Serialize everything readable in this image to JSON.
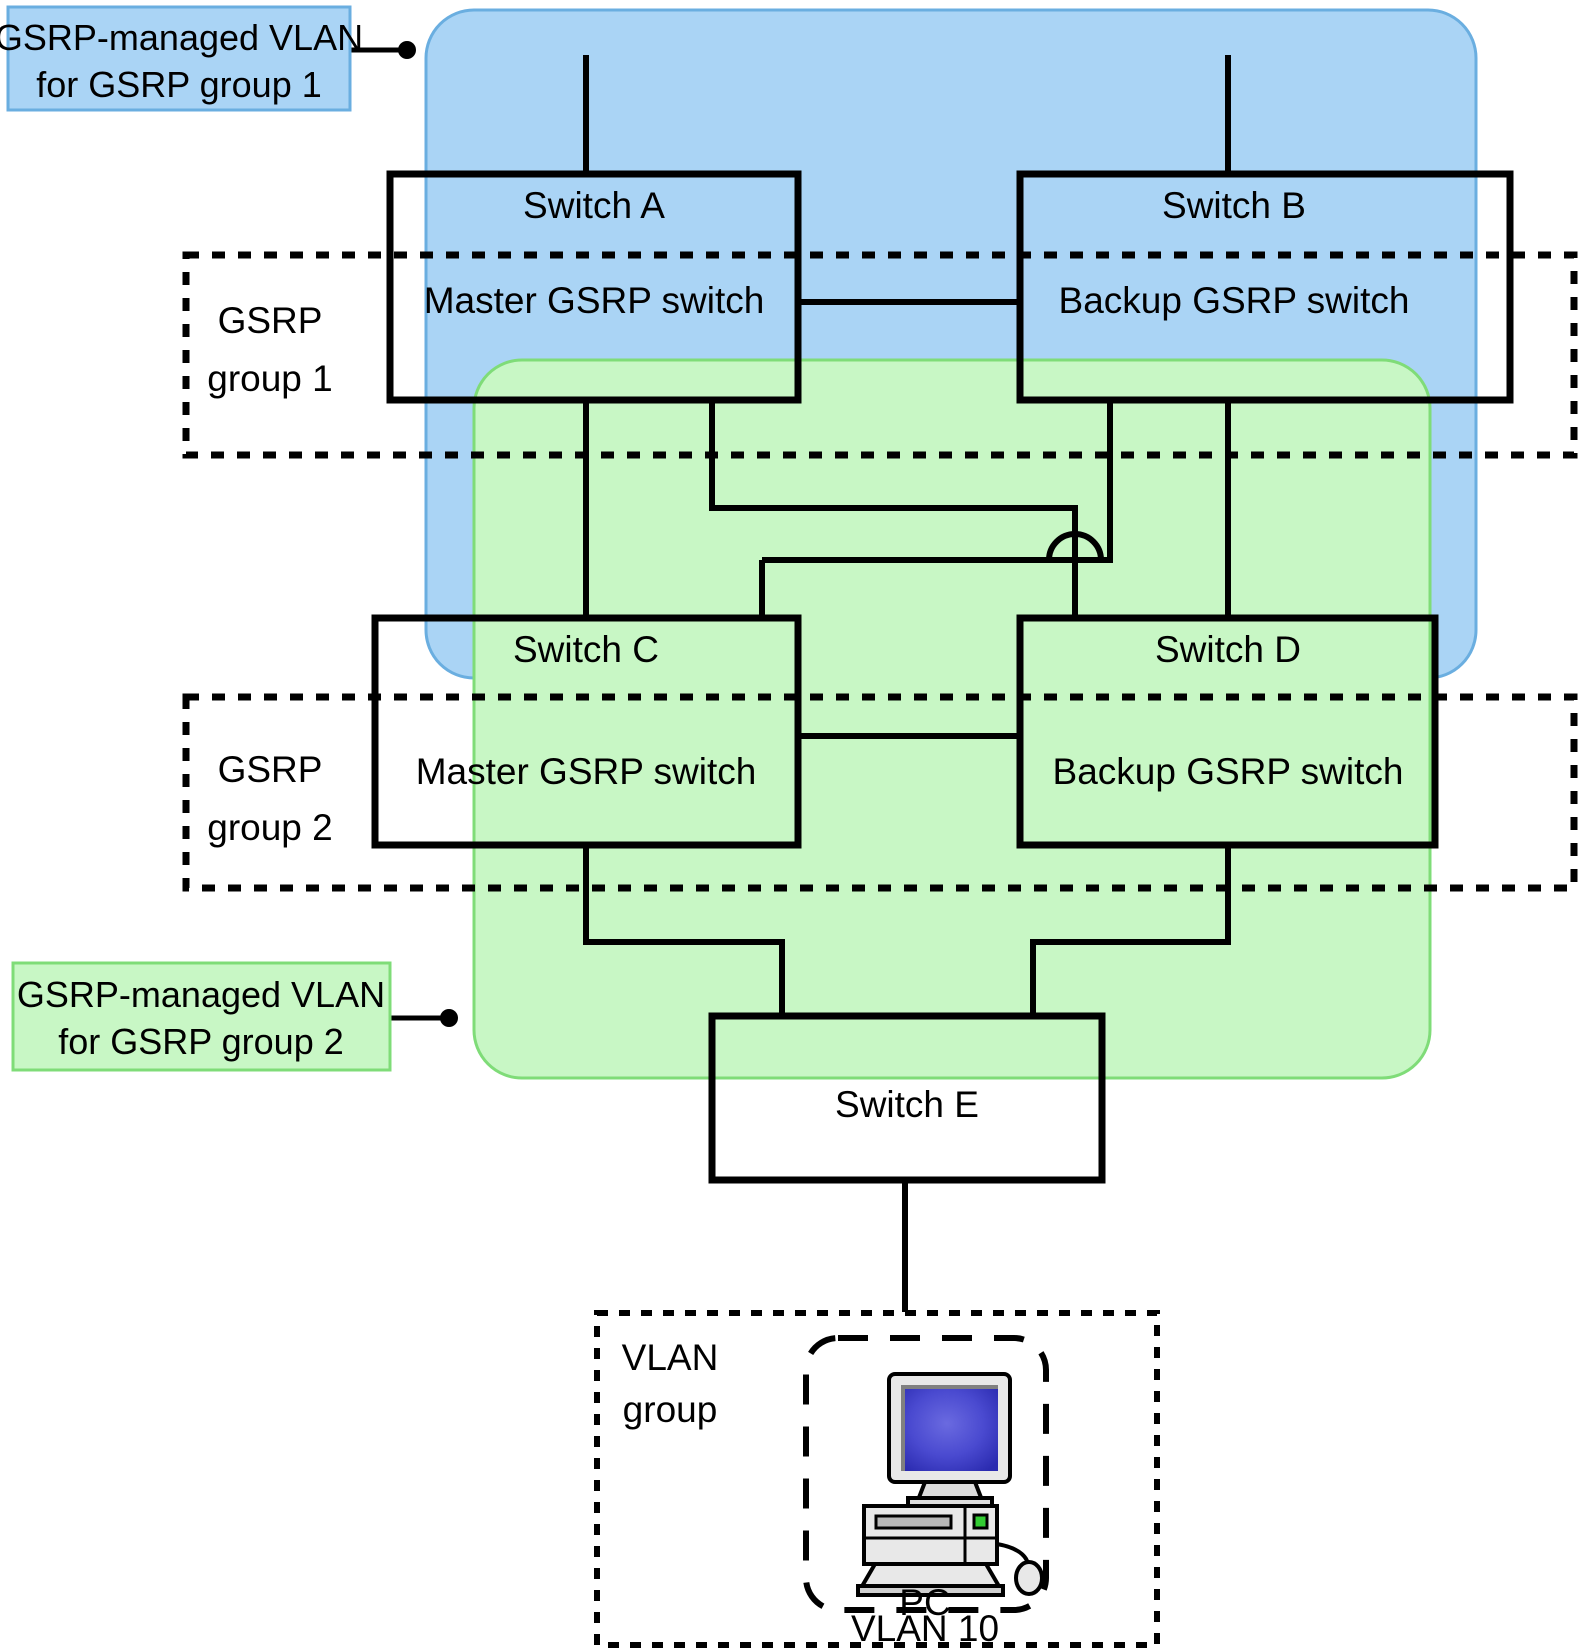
{
  "diagram": {
    "type": "network-topology",
    "title_present": false,
    "colors": {
      "vlan_group1_fill": "#aad4f5",
      "vlan_group1_stroke": "#6aaee0",
      "vlan_group2_fill": "#c8f7c5",
      "vlan_group2_stroke": "#7fdc78",
      "line": "#000000",
      "pc_screen": "#4040c0",
      "pc_case": "#e0e0e0",
      "pc_led": "#33cc33"
    },
    "legend": [
      {
        "id": "legend-group-1",
        "line1": "GSRP-managed VLAN",
        "line2": "for GSRP group 1",
        "fill": "#aad4f5"
      },
      {
        "id": "legend-group-2",
        "line1": "GSRP-managed VLAN",
        "line2": "for GSRP group 2",
        "fill": "#c8f7c5"
      }
    ],
    "group_boxes": [
      {
        "id": "gsrp-group-1-box",
        "line1": "GSRP",
        "line2": "group 1"
      },
      {
        "id": "gsrp-group-2-box",
        "line1": "GSRP",
        "line2": "group 2"
      }
    ],
    "switches": [
      {
        "id": "switch-a",
        "name": "Switch A",
        "role": "Master GSRP switch"
      },
      {
        "id": "switch-b",
        "name": "Switch B",
        "role": "Backup GSRP switch"
      },
      {
        "id": "switch-c",
        "name": "Switch C",
        "role": "Master GSRP switch"
      },
      {
        "id": "switch-d",
        "name": "Switch D",
        "role": "Backup GSRP switch"
      },
      {
        "id": "switch-e",
        "name": "Switch E",
        "role": ""
      }
    ],
    "vlan_group": {
      "label_line1": "VLAN",
      "label_line2": "group",
      "host": {
        "id": "pc-host",
        "label_line1": "PC",
        "label_line2": "VLAN 10",
        "icon": "desktop-computer-icon"
      }
    }
  }
}
